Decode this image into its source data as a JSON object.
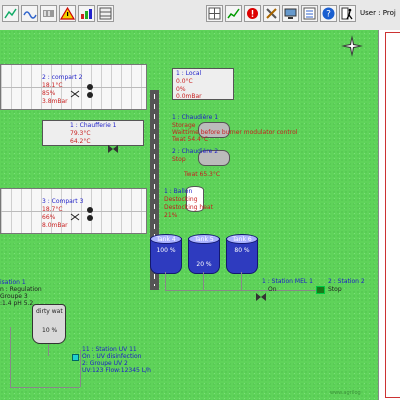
{
  "app": {
    "user_label": "User : Proj"
  },
  "colors": {
    "background": "#5fd35a",
    "tank": "#2e3bbf",
    "label_blue": "#1e1ec8",
    "label_red": "#c81e1e"
  },
  "toolbar_icons": [
    "graph-icon",
    "wave-icon",
    "heater-icon",
    "warning-icon",
    "bars-icon",
    "rack-icon",
    "grid-icon",
    "chart-icon",
    "stop-icon",
    "tools-icon",
    "monitor-icon",
    "list-icon",
    "help-icon",
    "exit-icon"
  ],
  "compass_icon": "compass-icon",
  "compartments": [
    {
      "name": "2 : compart 2",
      "temp": "18.1°C",
      "humidity": "85%",
      "pressure": "3.8mBar"
    },
    {
      "name": "3 : Compart 3",
      "temp": "18.7°C",
      "humidity": "66%",
      "pressure": "8.0mBar"
    }
  ],
  "local": {
    "name": "1 : Local",
    "temp": "0.0°C",
    "humidity": "0%",
    "pressure": "0.0mBar"
  },
  "chaufferie": {
    "name": "1 : Chaufferie 1",
    "t1": "79.3°C",
    "t2": "64.2°C"
  },
  "chaudiere1": {
    "name": "1 : Chaudière 1",
    "status": "Storage",
    "wait": "Waittime before burner modulator control",
    "twat": "Twat 54.4°C"
  },
  "chaudiere2": {
    "name": "2 : Chaudière 2",
    "status": "Stop",
    "twat": "Twat 65.3°C"
  },
  "ballon": {
    "name": "1 : Ballon",
    "status1": "Destocking",
    "status2": "Destocking heat",
    "level": "21%"
  },
  "tanks": [
    {
      "name": "Tank 4",
      "level": "100 %"
    },
    {
      "name": "Tank 5",
      "level": "20 %"
    },
    {
      "name": "Tank 6",
      "level": "80 %"
    }
  ],
  "station_mel": {
    "name": "1 : Station MEL 1",
    "status": "On"
  },
  "station2": {
    "name": "2 : Station 2",
    "status": "Stop"
  },
  "fertilisation": {
    "name": "isation 1",
    "mode": "n : Regulation",
    "group": "Groupe 3",
    "values": ":1.4  pH 5.2"
  },
  "dirty_water": {
    "name": "dirty wat",
    "level": "10 %"
  },
  "station_uv": {
    "name": "11 : Station UV 11",
    "status": "On : UV disinfection",
    "group": "2: Groupe UV 2",
    "values": "UV:123 Flow:12345 L/h"
  },
  "watermark": "www.agrilog"
}
